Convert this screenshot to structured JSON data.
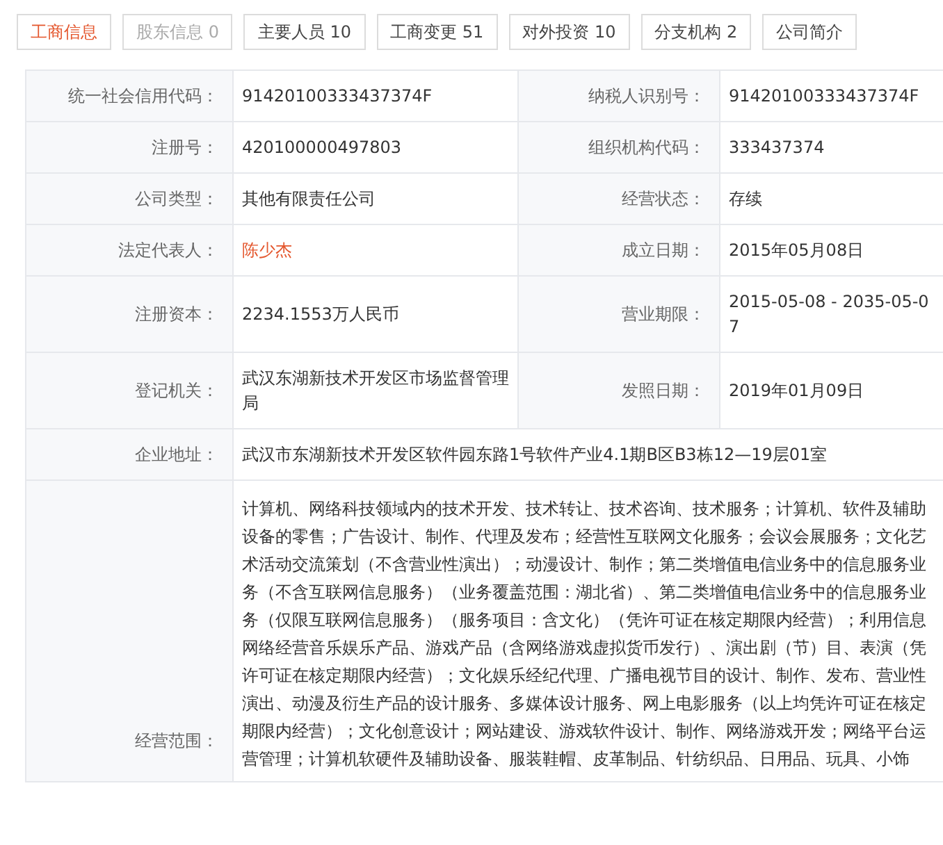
{
  "tabs": [
    {
      "label": "工商信息",
      "selected": true,
      "disabled": false
    },
    {
      "label": "股东信息 0",
      "selected": false,
      "disabled": true
    },
    {
      "label": "主要人员 10",
      "selected": false,
      "disabled": false
    },
    {
      "label": "工商变更 51",
      "selected": false,
      "disabled": false
    },
    {
      "label": "对外投资 10",
      "selected": false,
      "disabled": false
    },
    {
      "label": "分支机构 2",
      "selected": false,
      "disabled": false
    },
    {
      "label": "公司简介",
      "selected": false,
      "disabled": false
    }
  ],
  "rows": [
    [
      {
        "label": "统一社会信用代码：",
        "value": "91420100333437374F",
        "kind": "text"
      },
      {
        "label": "纳税人识别号：",
        "value": "91420100333437374F",
        "kind": "text"
      }
    ],
    [
      {
        "label": "注册号：",
        "value": "420100000497803",
        "kind": "text"
      },
      {
        "label": "组织机构代码：",
        "value": "333437374",
        "kind": "text"
      }
    ],
    [
      {
        "label": "公司类型：",
        "value": "其他有限责任公司",
        "kind": "text"
      },
      {
        "label": "经营状态：",
        "value": "存续",
        "kind": "text"
      }
    ],
    [
      {
        "label": "法定代表人：",
        "value": "陈少杰",
        "kind": "link"
      },
      {
        "label": "成立日期：",
        "value": "2015年05月08日",
        "kind": "text"
      }
    ],
    [
      {
        "label": "注册资本：",
        "value": "2234.1553万人民币",
        "kind": "text"
      },
      {
        "label": "营业期限：",
        "value": "2015-05-08 - 2035-05-07",
        "kind": "text"
      }
    ],
    [
      {
        "label": "登记机关：",
        "value": "武汉东湖新技术开发区市场监督管理局",
        "kind": "text"
      },
      {
        "label": "发照日期：",
        "value": "2019年01月09日",
        "kind": "text"
      }
    ],
    [
      {
        "label": "企业地址：",
        "value": "武汉市东湖新技术开发区软件园东路1号软件产业4.1期B区B3栋12—19层01室",
        "kind": "text"
      }
    ],
    [
      {
        "label": "经营范围：",
        "value": "计算机、网络科技领域内的技术开发、技术转让、技术咨询、技术服务；计算机、软件及辅助设备的零售；广告设计、制作、代理及发布；经营性互联网文化服务；会议会展服务；文化艺术活动交流策划（不含营业性演出）；动漫设计、制作；第二类增值电信业务中的信息服务业务（不含互联网信息服务）（业务覆盖范围：湖北省）、第二类增值电信业务中的信息服务业务（仅限互联网信息服务）（服务项目：含文化）（凭许可证在核定期限内经营）；利用信息网络经营音乐娱乐产品、游戏产品（含网络游戏虚拟货币发行）、演出剧（节）目、表演（凭许可证在核定期限内经营）；文化娱乐经纪代理、广播电视节目的设计、制作、发布、营业性演出、动漫及衍生产品的设计服务、多媒体设计服务、网上电影服务（以上均凭许可证在核定期限内经营）；文化创意设计；网站建设、游戏软件设计、制作、网络游戏开发；网络平台运营管理；计算机软硬件及辅助设备、服装鞋帽、皮革制品、针纺织品、日用品、玩具、小饰",
        "kind": "text"
      }
    ]
  ]
}
